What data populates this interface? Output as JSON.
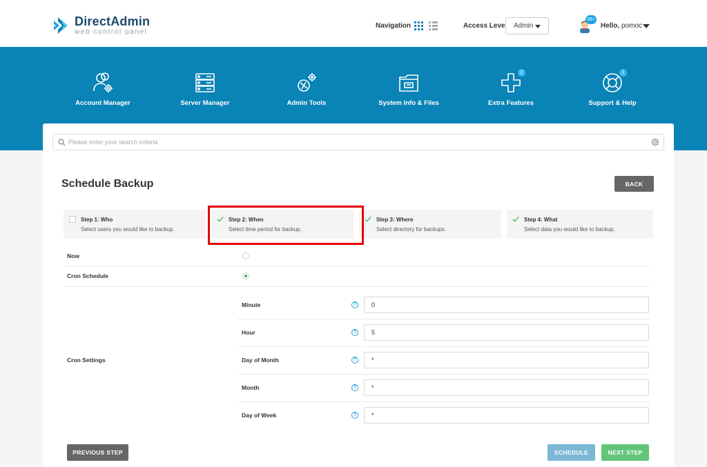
{
  "header": {
    "logo_title": "DirectAdmin",
    "logo_subtitle": "web control panel",
    "navigation_label": "Navigation",
    "access_level_label": "Access Level",
    "access_level_value": "Admin",
    "avatar_badge": "99+",
    "hello_label": "Hello,",
    "username": "pomoc"
  },
  "menu": {
    "items": [
      {
        "label": "Account Manager",
        "icon": "users-gear-icon"
      },
      {
        "label": "Server Manager",
        "icon": "server-icon"
      },
      {
        "label": "Admin Tools",
        "icon": "tools-icon"
      },
      {
        "label": "System Info & Files",
        "icon": "folder-icon"
      },
      {
        "label": "Extra Features",
        "icon": "plus-icon",
        "badge": "2"
      },
      {
        "label": "Support & Help",
        "icon": "lifebuoy-icon",
        "badge": "1"
      }
    ]
  },
  "search": {
    "placeholder": "Please enter your search criteria"
  },
  "page": {
    "title": "Schedule Backup",
    "back_label": "BACK"
  },
  "steps": [
    {
      "title": "Step 1: Who",
      "desc": "Select users you would like to backup.",
      "checked": false
    },
    {
      "title": "Step 2: When",
      "desc": "Select time period for backup.",
      "checked": true
    },
    {
      "title": "Step 3: Where",
      "desc": "Select directory for backups.",
      "checked": true
    },
    {
      "title": "Step 4: What",
      "desc": "Select data you would like to backup.",
      "checked": true
    }
  ],
  "form": {
    "now_label": "Now",
    "cron_schedule_label": "Cron Schedule",
    "cron_settings_label": "Cron Settings",
    "selected_option": "Cron Schedule",
    "fields": [
      {
        "label": "Minute",
        "value": "0"
      },
      {
        "label": "Hour",
        "value": "5"
      },
      {
        "label": "Day of Month",
        "value": "*"
      },
      {
        "label": "Month",
        "value": "*"
      },
      {
        "label": "Day of Week",
        "value": "*"
      }
    ],
    "help_glyph": "?"
  },
  "footer": {
    "previous_label": "PREVIOUS STEP",
    "schedule_label": "SCHEDULE",
    "next_label": "NEXT STEP"
  },
  "colors": {
    "brand_blue": "#0a83b6",
    "badge_blue": "#1ea4e0",
    "success_green": "#62c57a",
    "highlight_red": "#e20000"
  }
}
